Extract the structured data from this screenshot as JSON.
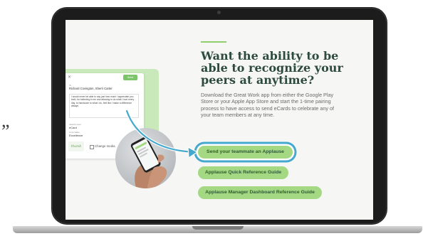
{
  "left_quote": "”",
  "hero": {
    "heading": "Want the ability to be able to recognize your peers at anytime?",
    "description": "Download the Great Work app from either the Google Play Store or your Apple App Store and start the 1-time pairing process to have access to send eCards to celebrate any of your team members at any time."
  },
  "buttons": {
    "primary": "Send your teammate an Applause",
    "quick_guide": "Applause Quick Reference Guide",
    "manager_guide": "Applause Manager Dashboard Reference Guide"
  },
  "ecard": {
    "close": "✕",
    "send_label": "Send",
    "to_label": "To",
    "recipients": "Richard Covington, Sherri Carter",
    "message": "I would never be able to say just how much I appreciate you both, for believing in me and allowing to do what I love every day, to handcode to what I do, feel like I make a difference always",
    "award_label": "Award Level",
    "award": "eCard",
    "value_label": "Core Value",
    "value": "Excellence",
    "thumb_text": "thank",
    "change_media": "Change media"
  },
  "colors": {
    "button_green": "#a4d883",
    "highlight_blue": "#45a8cf",
    "heading_text": "#2d4a3e",
    "accent_green": "#8fcf6b"
  }
}
